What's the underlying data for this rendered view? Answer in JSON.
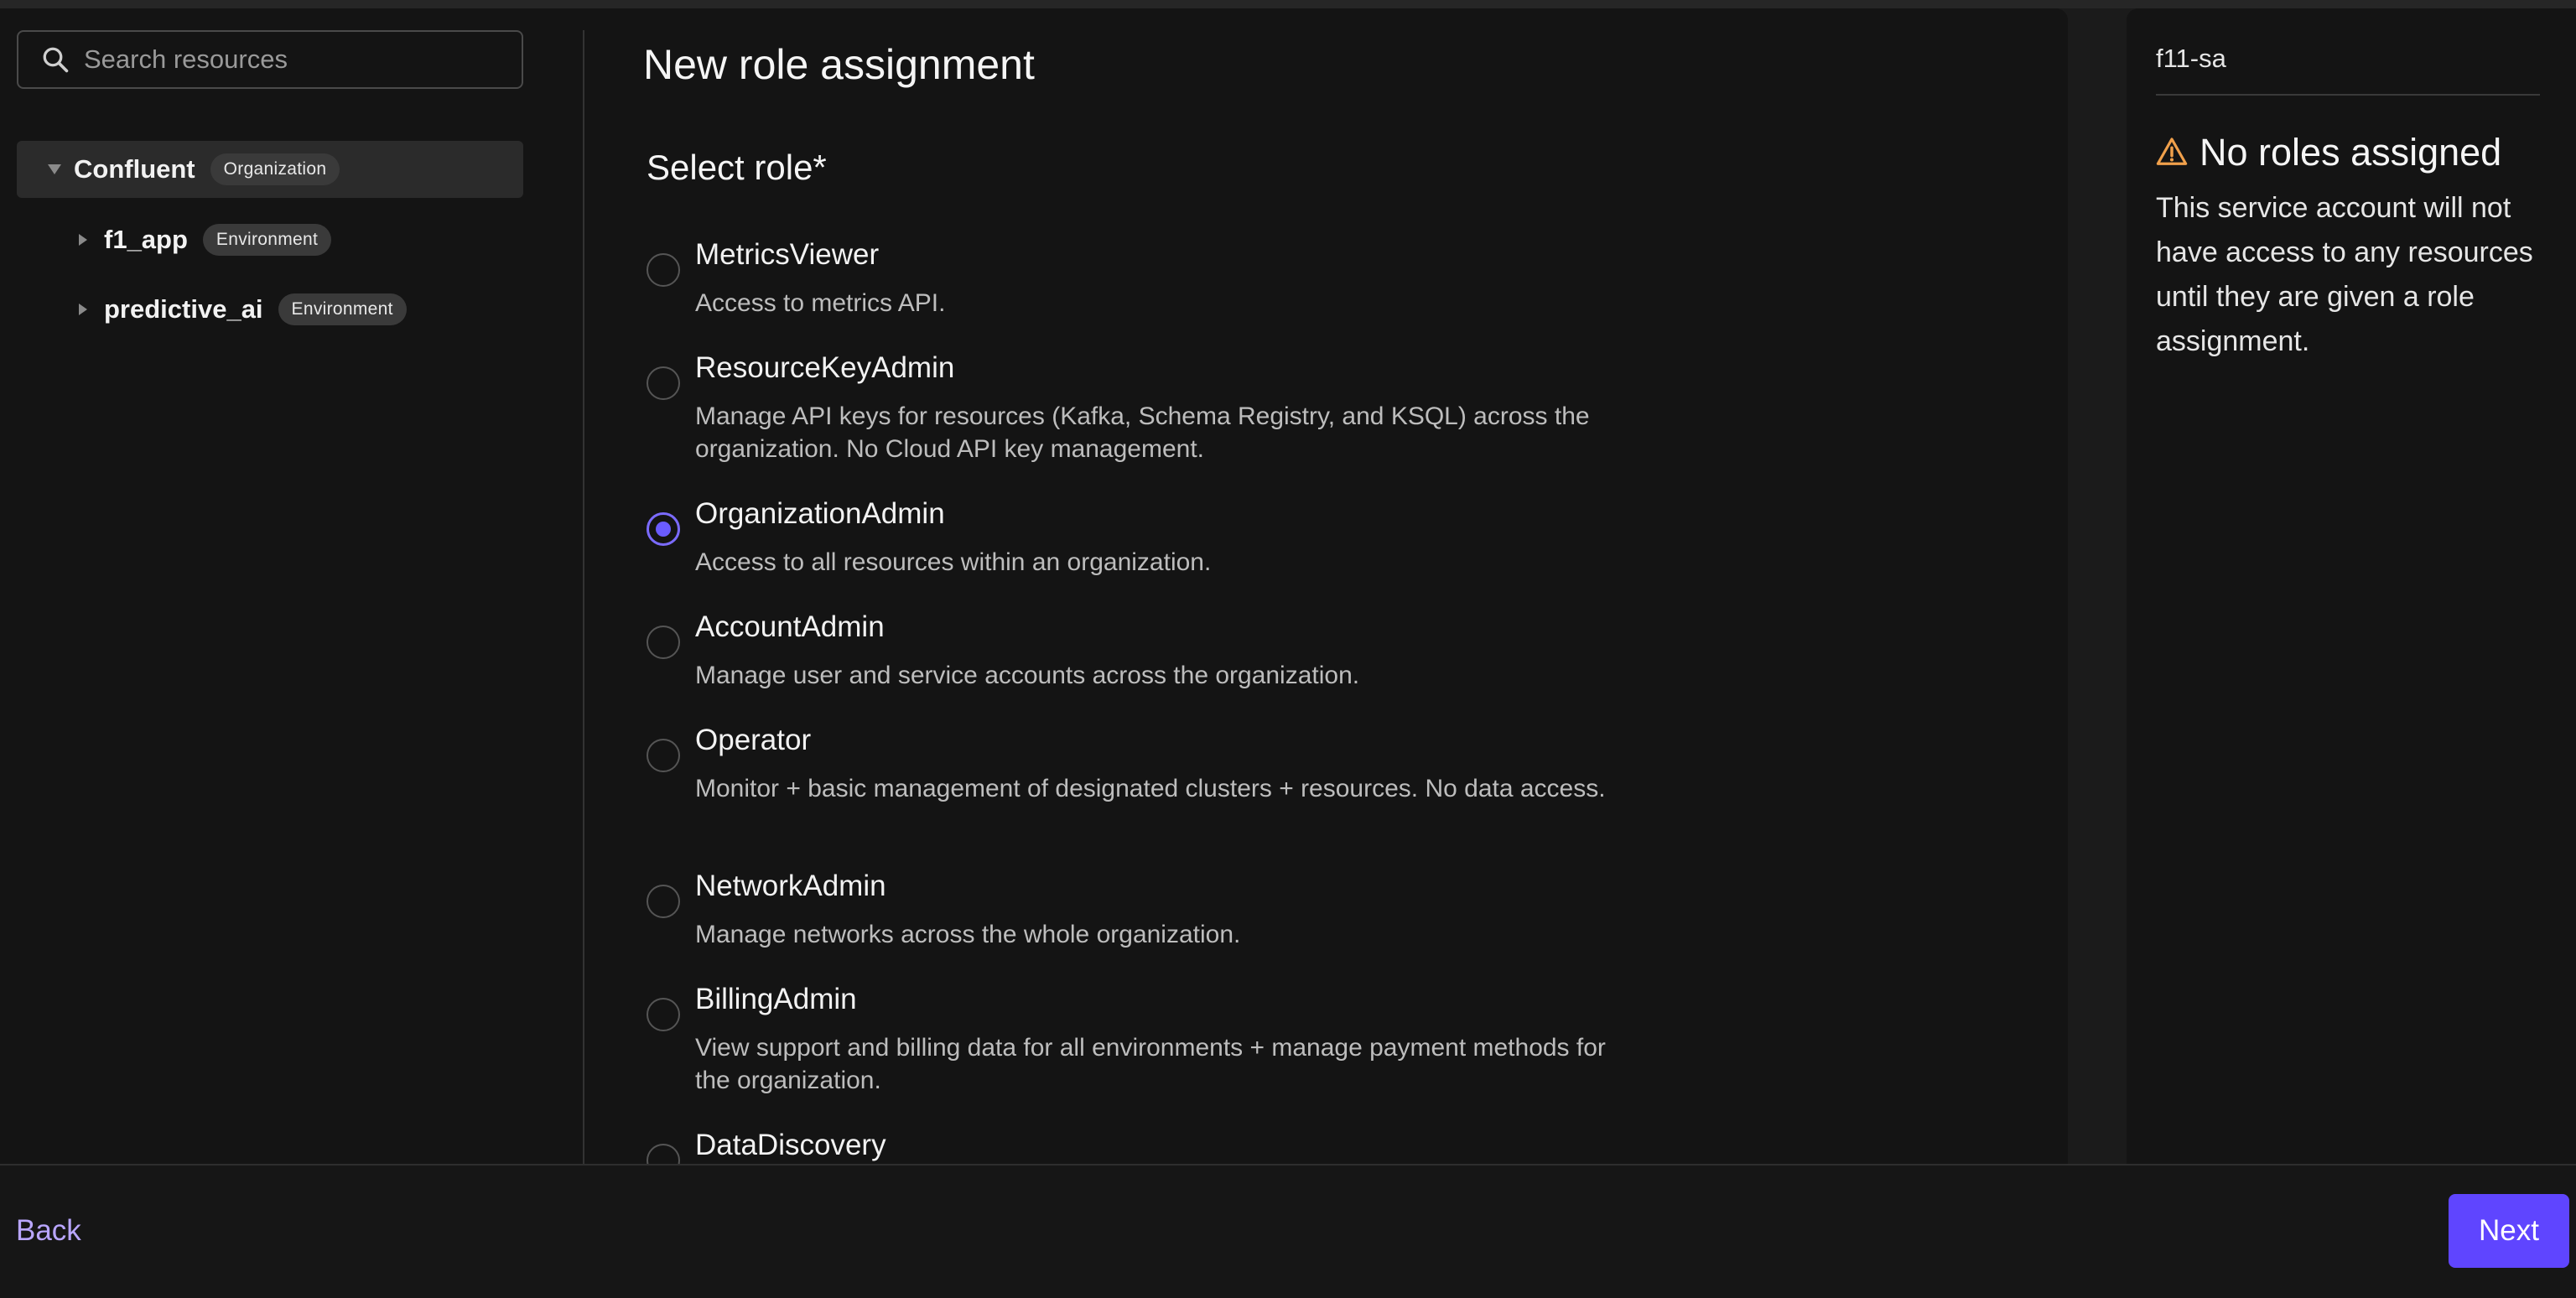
{
  "search": {
    "placeholder": "Search resources"
  },
  "tree": {
    "org": {
      "name": "Confluent",
      "badge": "Organization"
    },
    "environments": [
      {
        "name": "f1_app",
        "badge": "Environment"
      },
      {
        "name": "predictive_ai",
        "badge": "Environment"
      }
    ]
  },
  "main": {
    "title": "New role assignment",
    "section_title": "Select role*",
    "roles": [
      {
        "name": "MetricsViewer",
        "desc": "Access to metrics API.",
        "checked": false
      },
      {
        "name": "ResourceKeyAdmin",
        "desc": "Manage API keys for resources (Kafka, Schema Registry, and KSQL) across the organization. No Cloud API key management.",
        "checked": false
      },
      {
        "name": "OrganizationAdmin",
        "desc": "Access to all resources within an organization.",
        "checked": true
      },
      {
        "name": "AccountAdmin",
        "desc": "Manage user and service accounts across the organization.",
        "checked": false
      },
      {
        "name": "Operator",
        "desc": "Monitor + basic management of designated clusters + resources. No data access.",
        "checked": false
      },
      {
        "name": "NetworkAdmin",
        "desc": "Manage networks across the whole organization.",
        "checked": false
      },
      {
        "name": "BillingAdmin",
        "desc": "View support and billing data for all environments + manage payment methods for the organization.",
        "checked": false
      },
      {
        "name": "DataDiscovery",
        "desc": "",
        "checked": false
      }
    ]
  },
  "summary": {
    "account_name": "f11-sa",
    "warning_title": "No roles assigned",
    "warning_body": "This service account will not have access to any resources until they are given a role assignment."
  },
  "footer": {
    "back_label": "Back",
    "next_label": "Next"
  },
  "colors": {
    "accent": "#5f45ff",
    "link": "#b9a6ff",
    "warning": "#f0a04b"
  }
}
